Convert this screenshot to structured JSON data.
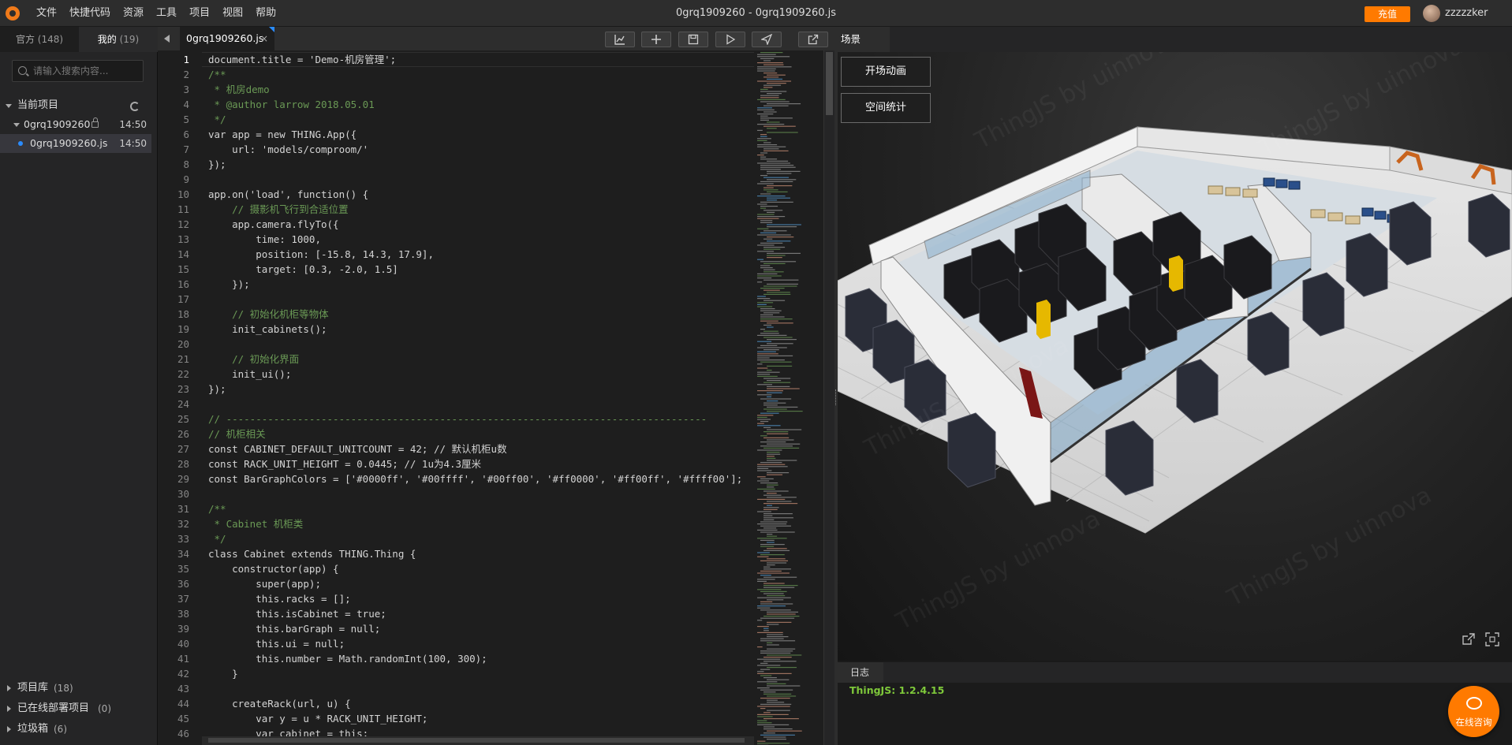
{
  "app": {
    "window_title": "0grq1909260 - 0grq1909260.js",
    "menu": [
      "文件",
      "快捷代码",
      "资源",
      "工具",
      "项目",
      "视图",
      "帮助"
    ],
    "recharge_label": "充值",
    "username": "zzzzzker",
    "accent_color": "#ff7a00"
  },
  "sidebar": {
    "tabs": [
      {
        "label": "官方",
        "count": "(148)"
      },
      {
        "label": "我的",
        "count": "(19)"
      }
    ],
    "search_placeholder": "请输入搜索内容...",
    "current_project_label": "当前项目",
    "project": {
      "name": "0grq1909260",
      "time": "14:50"
    },
    "file": {
      "name": "0grq1909260.js",
      "time": "14:50"
    },
    "bottom_groups": [
      {
        "label": "项目库",
        "count": "(18)"
      },
      {
        "label": "已在线部署项目",
        "count": "(0)"
      },
      {
        "label": "垃圾箱",
        "count": "(6)"
      }
    ]
  },
  "editor": {
    "tab_label": "0grq1909260.js",
    "tab_close": "×",
    "toolbar_icons": [
      "chart-icon",
      "plus-icon",
      "save-icon",
      "run-icon",
      "send-icon",
      "external-icon"
    ],
    "line_numbers": [
      "1",
      "2",
      "3",
      "4",
      "5",
      "6",
      "7",
      "8",
      "9",
      "10",
      "11",
      "12",
      "13",
      "14",
      "15",
      "16",
      "17",
      "18",
      "19",
      "20",
      "21",
      "22",
      "23",
      "24",
      "25",
      "26",
      "27",
      "28",
      "29",
      "30",
      "31",
      "32",
      "33",
      "34",
      "35",
      "36",
      "37",
      "38",
      "39",
      "40",
      "41",
      "42",
      "43",
      "44",
      "45",
      "46"
    ],
    "code_lines": [
      "document.title = 'Demo-机房管理';",
      "/**",
      " * 机房demo",
      " * @author larrow 2018.05.01",
      " */",
      "var app = new THING.App({",
      "    url: 'models/comproom/'",
      "});",
      "",
      "app.on('load', function() {",
      "    // 摄影机飞行到合适位置",
      "    app.camera.flyTo({",
      "        time: 1000,",
      "        position: [-15.8, 14.3, 17.9],",
      "        target: [0.3, -2.0, 1.5]",
      "    });",
      "",
      "    // 初始化机柜等物体",
      "    init_cabinets();",
      "",
      "    // 初始化界面",
      "    init_ui();",
      "});",
      "",
      "// ---------------------------------------------------------------------------------",
      "// 机柜相关",
      "const CABINET_DEFAULT_UNITCOUNT = 42; // 默认机柜u数",
      "const RACK_UNIT_HEIGHT = 0.0445; // 1u为4.3厘米",
      "const BarGraphColors = ['#0000ff', '#00ffff', '#00ff00', '#ff0000', '#ff00ff', '#ffff00'];",
      "",
      "/**",
      " * Cabinet 机柜类",
      " */",
      "class Cabinet extends THING.Thing {",
      "    constructor(app) {",
      "        super(app);",
      "        this.racks = [];",
      "        this.isCabinet = true;",
      "        this.barGraph = null;",
      "        this.ui = null;",
      "        this.number = Math.randomInt(100, 300);",
      "    }",
      "",
      "    createRack(url, u) {",
      "        var y = u * RACK_UNIT_HEIGHT;",
      "        var cabinet = this;"
    ]
  },
  "scene": {
    "tab_label": "场景",
    "buttons": [
      "开场动画",
      "空间统计"
    ],
    "watermark": "ThingJS by uinnova"
  },
  "log": {
    "tab_label": "日志",
    "line": "ThingJS: 1.2.4.15"
  },
  "chat": {
    "label": "在线咨询"
  }
}
